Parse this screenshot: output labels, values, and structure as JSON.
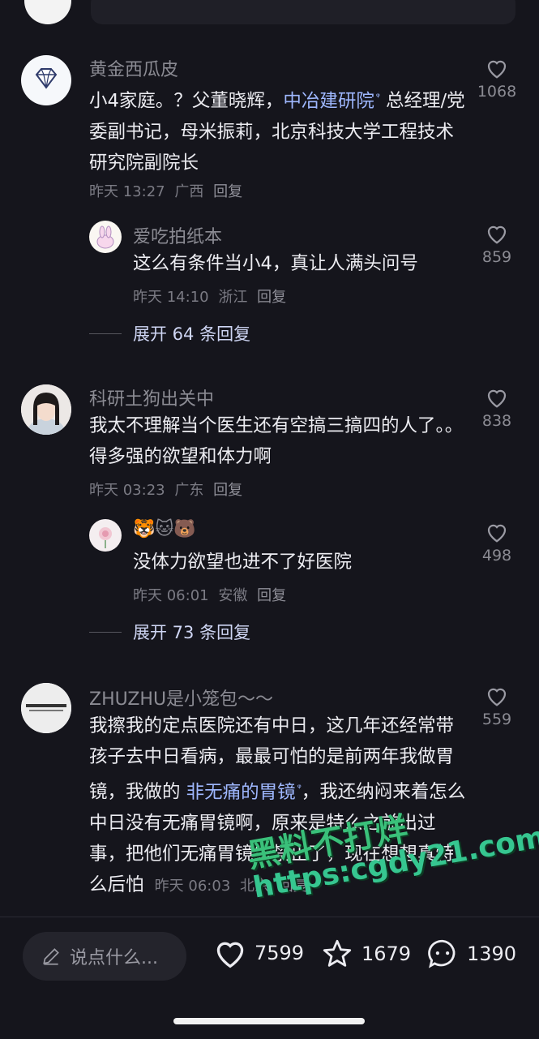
{
  "comments": [
    {
      "username": "黄金西瓜皮",
      "text_before": "小4家庭。？父董晓辉，",
      "link": "中冶建研院",
      "text_after": "总经理/党委副书记，母米振莉，北京科技大学工程技术研究院副院长",
      "time": "昨天 13:27",
      "location": "广西",
      "reply": "回复",
      "likes": "1068",
      "subreply": {
        "username": "爱吃拍纸本",
        "text": "这么有条件当小4，真让人满头问号",
        "time": "昨天 14:10",
        "location": "浙江",
        "reply": "回复",
        "likes": "859"
      },
      "expand": "展开 64 条回复"
    },
    {
      "username": "科研土狗出关中",
      "text": "我太不理解当个医生还有空搞三搞四的人了。。得多强的欲望和体力啊",
      "time": "昨天 03:23",
      "location": "广东",
      "reply": "回复",
      "likes": "838",
      "subreply": {
        "username": "🐯🐱🐻",
        "text": "没体力欲望也进不了好医院",
        "time": "昨天 06:01",
        "location": "安徽",
        "reply": "回复",
        "likes": "498"
      },
      "expand": "展开 73 条回复"
    },
    {
      "username": "ZHUZHU是小笼包～～",
      "text_before": "我擦我的定点医院还有中日，这几年还经常带孩子去中日看病，最最可怕的是前两年我做胃镜，我做的",
      "link": "非无痛的胃镜",
      "text_after": "，我还纳闷来着怎么中日没有无痛胃镜啊，原来是特么之前出过事，把他们无痛胃镜给禁止了，现在想想真特么后怕",
      "time": "昨天 06:03",
      "location": "北京",
      "reply": "回复",
      "likes": "559"
    }
  ],
  "bottom": {
    "say_placeholder": "说点什么...",
    "likes": "7599",
    "favorites": "1679",
    "comments": "1390"
  },
  "watermark": {
    "line1": "黑料不打烊",
    "line2": "https:cgdy21.com"
  },
  "icons": {
    "heart": "heart-icon",
    "star": "star-icon",
    "comment": "comment-bubble-icon",
    "pencil": "pencil-icon",
    "search_mark": "search-mark-icon"
  },
  "colors": {
    "background": "#15151c",
    "link": "#9fb8ff",
    "watermark": "#3ac07a"
  }
}
